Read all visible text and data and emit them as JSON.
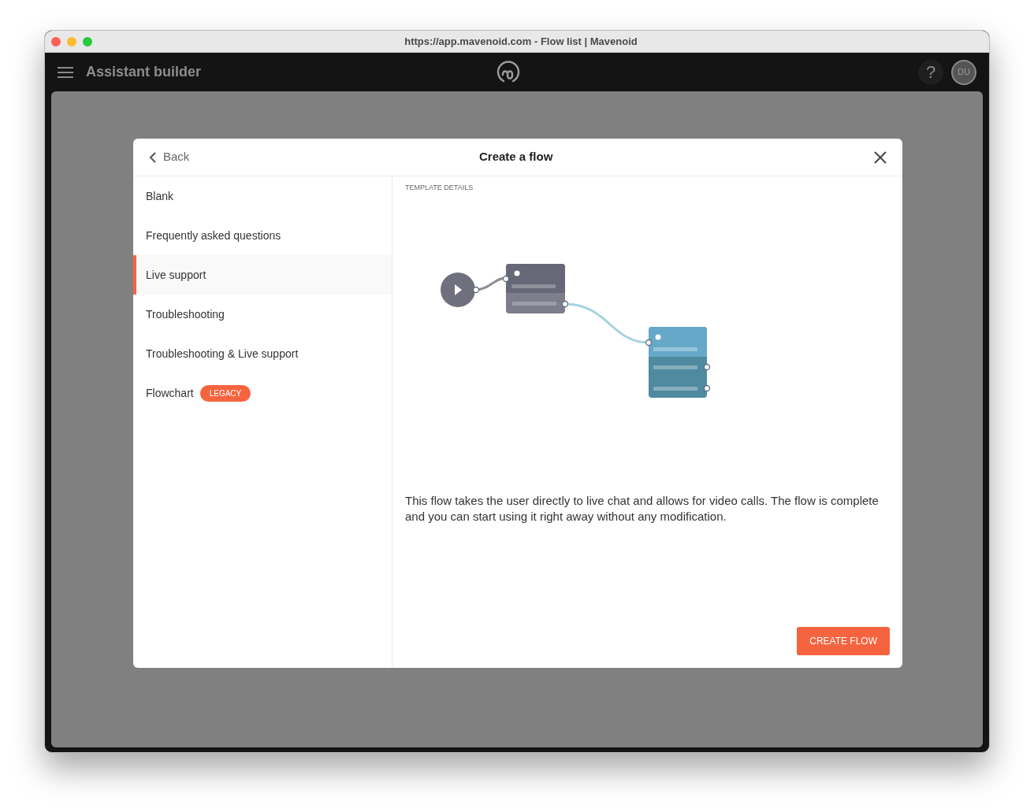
{
  "browser": {
    "title": "https://app.mavenoid.com - Flow list | Mavenoid"
  },
  "app_bar": {
    "title": "Assistant builder",
    "help": "?",
    "avatar": "DU"
  },
  "dialog": {
    "back": "Back",
    "title": "Create a flow",
    "templates": [
      {
        "label": "Blank",
        "selected": false
      },
      {
        "label": "Frequently asked questions",
        "selected": false
      },
      {
        "label": "Live support",
        "selected": true
      },
      {
        "label": "Troubleshooting",
        "selected": false
      },
      {
        "label": "Troubleshooting & Live support",
        "selected": false
      },
      {
        "label": "Flowchart",
        "selected": false,
        "badge": "LEGACY"
      }
    ],
    "details_heading": "TEMPLATE DETAILS",
    "description": "This flow takes the user directly to live chat and allows for video calls. The flow is complete and you can start using it right away without any modification.",
    "create_button": "CREATE FLOW"
  }
}
